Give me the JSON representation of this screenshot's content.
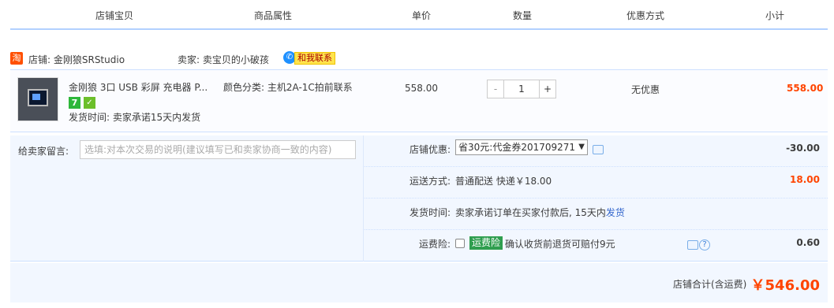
{
  "header": {
    "col_shop_item": "店铺宝贝",
    "col_attributes": "商品属性",
    "col_unit_price": "单价",
    "col_quantity": "数量",
    "col_discount": "优惠方式",
    "col_subtotal": "小计"
  },
  "shop": {
    "tao_icon": "淘",
    "shop_name": "店铺: 金刚狼SRStudio",
    "seller": "卖家: 卖宝贝的小破孩",
    "contact_label": "和我联系"
  },
  "item": {
    "title": "金刚狼 3口 USB 彩屏 充电器 P...",
    "badge_7": "7",
    "ship_time": "发货时间: 卖家承诺15天内发货",
    "attributes": "颜色分类: 主机2A-1C拍前联系",
    "unit_price": "558.00",
    "quantity": "1",
    "minus": "-",
    "plus": "+",
    "discount": "无优惠",
    "subtotal": "558.00"
  },
  "order": {
    "message_label": "给卖家留言:",
    "message_placeholder": "选填:对本次交易的说明(建议填写已和卖家协商一致的内容)",
    "shop_discount_label": "店铺优惠:",
    "shop_discount_select": "省30元:代金券201709271",
    "shop_discount_value": "-30.00",
    "shipping_label": "运送方式:",
    "shipping_method": "普通配送 快递￥18.00",
    "shipping_value": "18.00",
    "delivery_label": "发货时间:",
    "delivery_text": "卖家承诺订单在买家付款后, 15天内",
    "delivery_link": "发货",
    "insurance_label": "运费险:",
    "insurance_badge": "运费险",
    "insurance_text": "确认收货前退货可赔付9元",
    "insurance_value": "0.60"
  },
  "total": {
    "label": "店铺合计(含运费)",
    "value": "￥546.00"
  },
  "colors": {
    "accent_price": "#ff4400",
    "header_line": "#b2d1ff",
    "panel_bg": "#f2f7ff"
  }
}
